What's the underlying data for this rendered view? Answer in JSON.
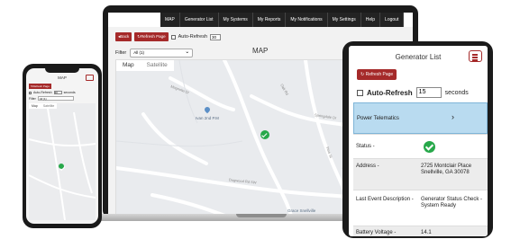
{
  "laptop": {
    "nav": [
      "MAP",
      "Generator List",
      "My Systems",
      "My Reports",
      "My Notifications",
      "My Settings",
      "Help",
      "Logout"
    ],
    "back_label": "Back",
    "refresh_label": "Refresh Page",
    "auto_refresh_label": "Auto-Refresh",
    "auto_refresh_value": "30",
    "filter_label": "Filter",
    "filter_value": "All (1)",
    "map_title": "MAP",
    "map_tab": "Map",
    "satellite_tab": "Satellite",
    "map_place": "Ivan 2nd P.M",
    "map_place2": "Grace Snellville",
    "roads": [
      "Dogwood Rd SW",
      "Springdale Dr",
      "Magnolia Dr",
      "Sherwood Dr",
      "Oak Rd",
      "Pine St"
    ]
  },
  "phone": {
    "title": "MAP",
    "refresh_label": "Refresh Page",
    "auto_refresh_label": "Auto-Refresh",
    "auto_refresh_value": "30",
    "seconds_label": "seconds",
    "filter_label": "Filter",
    "filter_value": "All (1)",
    "map_tab": "Map",
    "satellite_tab": "Satellite"
  },
  "tablet": {
    "title": "Generator List",
    "refresh_label": "Refresh Page",
    "auto_refresh_label": "Auto-Refresh",
    "auto_refresh_value": "15",
    "seconds_label": "seconds",
    "rows": [
      {
        "label": "Power Telematics",
        "value": "›"
      },
      {
        "label": "Status -",
        "value": ""
      },
      {
        "label": "Address -",
        "value": "2725 Montclair Place Snellville, GA 30078"
      },
      {
        "label": "Last Event Description -",
        "value": "Generator Status Check - System Ready"
      },
      {
        "label": "Battery Voltage -",
        "value": "14.1"
      }
    ]
  },
  "colors": {
    "accent": "#a52a2a",
    "status_ok": "#27a84a",
    "highlight": "#b9dbf0"
  }
}
